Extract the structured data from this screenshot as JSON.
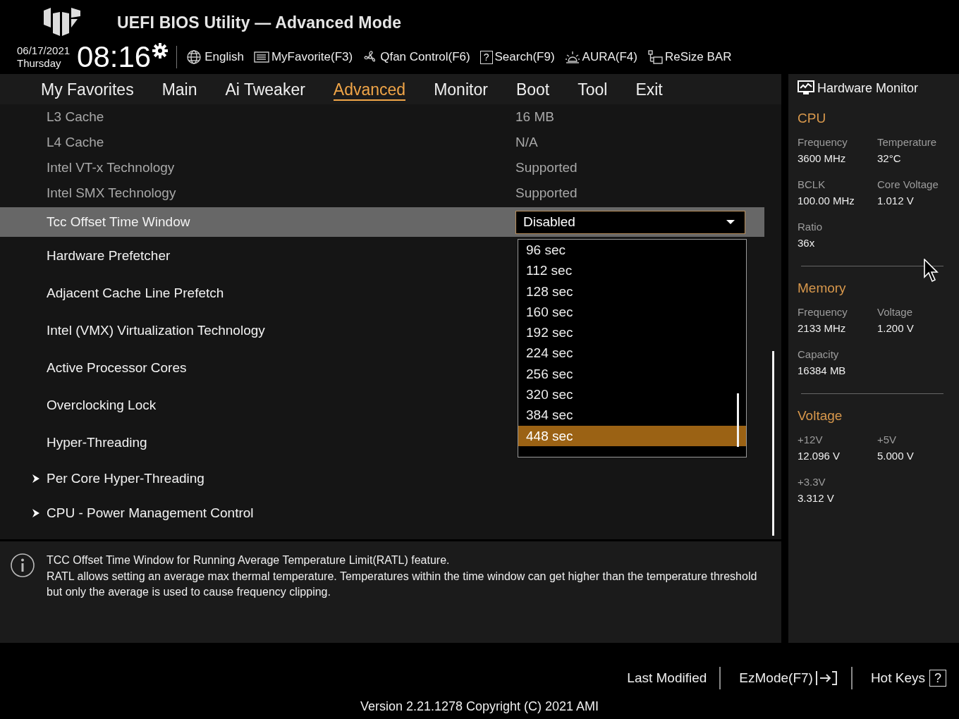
{
  "header": {
    "title": "UEFI BIOS Utility — Advanced Mode",
    "date": "06/17/2021",
    "day": "Thursday",
    "time": "08:16",
    "toolbar": [
      {
        "kind": "globe",
        "label": "English"
      },
      {
        "kind": "favorite",
        "label": "MyFavorite(F3)"
      },
      {
        "kind": "fan",
        "label": "Qfan Control(F6)"
      },
      {
        "kind": "search",
        "glyph": "?",
        "label": "Search(F9)"
      },
      {
        "kind": "aura",
        "label": "AURA(F4)"
      },
      {
        "kind": "resize",
        "label": "ReSize BAR"
      }
    ]
  },
  "menu_tabs": [
    {
      "label": "My Favorites",
      "selected": false
    },
    {
      "label": "Main",
      "selected": false
    },
    {
      "label": "Ai Tweaker",
      "selected": false
    },
    {
      "label": "Advanced",
      "selected": true
    },
    {
      "label": "Monitor",
      "selected": false
    },
    {
      "label": "Boot",
      "selected": false
    },
    {
      "label": "Tool",
      "selected": false
    },
    {
      "label": "Exit",
      "selected": false
    }
  ],
  "settings": [
    {
      "kind": "info",
      "label": "L3 Cache",
      "value": "16 MB",
      "selected": false
    },
    {
      "kind": "info",
      "label": "L4 Cache",
      "value": "N/A",
      "selected": false
    },
    {
      "kind": "info",
      "label": "Intel VT-x Technology",
      "value": "Supported",
      "selected": false
    },
    {
      "kind": "info",
      "label": "Intel SMX Technology",
      "value": "Supported",
      "selected": false
    },
    {
      "kind": "dropdown",
      "label": "Tcc Offset Time Window",
      "value": "Disabled",
      "selected": true
    },
    {
      "kind": "option",
      "label": "Hardware Prefetcher",
      "selected": false
    },
    {
      "kind": "option",
      "label": "Adjacent Cache Line Prefetch",
      "selected": false
    },
    {
      "kind": "option",
      "label": "Intel (VMX) Virtualization Technology",
      "selected": false
    },
    {
      "kind": "option",
      "label": "Active Processor Cores",
      "selected": false
    },
    {
      "kind": "option",
      "label": "Overclocking Lock",
      "selected": false
    },
    {
      "kind": "option",
      "label": "Hyper-Threading",
      "selected": false
    },
    {
      "kind": "submenu",
      "label": "Per Core Hyper-Threading",
      "selected": false
    },
    {
      "kind": "submenu",
      "label": "CPU - Power Management Control",
      "selected": false
    }
  ],
  "dropdown_options": [
    {
      "label": "96 sec",
      "selected": false
    },
    {
      "label": "112 sec",
      "selected": false
    },
    {
      "label": "128 sec",
      "selected": false
    },
    {
      "label": "160 sec",
      "selected": false
    },
    {
      "label": "192 sec",
      "selected": false
    },
    {
      "label": "224 sec",
      "selected": false
    },
    {
      "label": "256 sec",
      "selected": false
    },
    {
      "label": "320 sec",
      "selected": false
    },
    {
      "label": "384 sec",
      "selected": false
    },
    {
      "label": "448 sec",
      "selected": true
    }
  ],
  "help": {
    "lines": [
      "TCC Offset Time Window for Running Average Temperature Limit(RATL) feature.",
      "RATL allows setting an average max thermal temperature. Temperatures within the time window can get higher than the temperature threshold but only the average is used to cause frequency clipping."
    ]
  },
  "hardware_monitor": {
    "title": "Hardware Monitor",
    "sections": [
      {
        "title": "CPU",
        "items": [
          {
            "label": "Frequency",
            "value": "3600 MHz"
          },
          {
            "label": "Temperature",
            "value": "32°C"
          },
          {
            "label": "BCLK",
            "value": "100.00 MHz"
          },
          {
            "label": "Core Voltage",
            "value": "1.012 V"
          },
          {
            "label": "Ratio",
            "value": "36x"
          }
        ]
      },
      {
        "title": "Memory",
        "items": [
          {
            "label": "Frequency",
            "value": "2133 MHz"
          },
          {
            "label": "Voltage",
            "value": "1.200 V"
          },
          {
            "label": "Capacity",
            "value": "16384 MB"
          }
        ]
      },
      {
        "title": "Voltage",
        "items": [
          {
            "label": "+12V",
            "value": "12.096 V"
          },
          {
            "label": "+5V",
            "value": "5.000 V"
          },
          {
            "label": "+3.3V",
            "value": "3.312 V"
          }
        ]
      }
    ]
  },
  "footer": {
    "buttons": [
      {
        "kind": "plain",
        "label": "Last Modified"
      },
      {
        "kind": "exit",
        "label": "EzMode(F7)"
      },
      {
        "kind": "help",
        "label": "Hot Keys",
        "glyph": "?"
      }
    ],
    "version": "Version 2.21.1278 Copyright (C) 2021 AMI"
  }
}
